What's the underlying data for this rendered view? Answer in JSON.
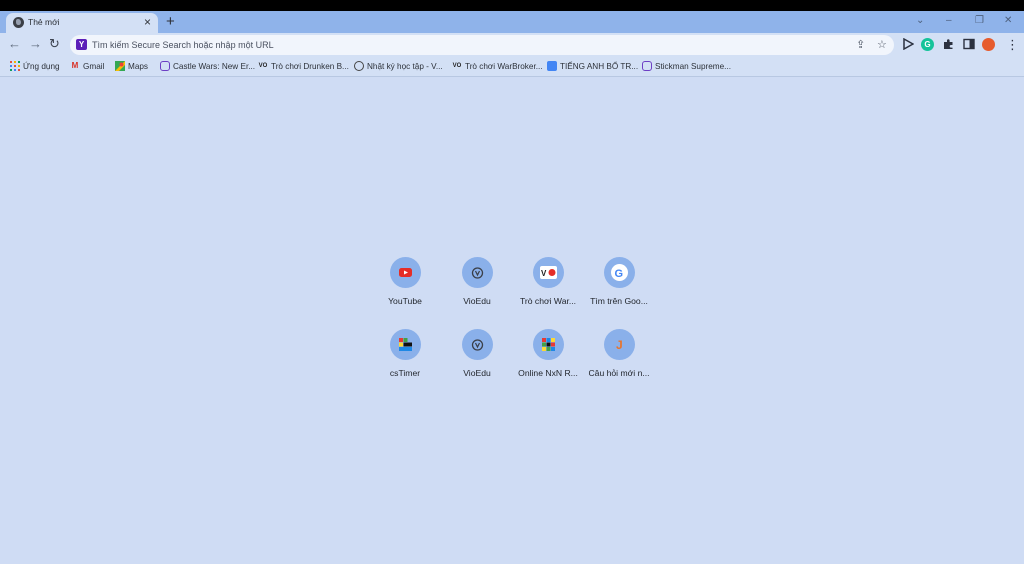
{
  "tab": {
    "title": "Thẻ mới",
    "close": "×",
    "new_tab": "+"
  },
  "window_controls": {
    "chevron": "⌄",
    "minimize": "–",
    "restore": "❐",
    "close": "✕"
  },
  "toolbar": {
    "back": "←",
    "forward": "→",
    "reload": "↻",
    "omnibox_placeholder": "Tìm kiếm Secure Search hoặc nhập một URL",
    "share": "⇪",
    "star": "☆",
    "menu": "⋮"
  },
  "bookmarks": [
    {
      "label": "Ứng dụng",
      "icon": "apps-grid-icon"
    },
    {
      "label": "Gmail",
      "icon": "gmail-icon"
    },
    {
      "label": "Maps",
      "icon": "maps-icon"
    },
    {
      "label": "Castle Wars: New Er...",
      "icon": "castle-wars-icon"
    },
    {
      "label": "Trò chơi Drunken B...",
      "icon": "vo-icon"
    },
    {
      "label": "Nhật ký học tập - V...",
      "icon": "vioedu-icon"
    },
    {
      "label": "Trò chơi WarBroker...",
      "icon": "vo-icon"
    },
    {
      "label": "TIẾNG ANH BỔ TR...",
      "icon": "docs-icon"
    },
    {
      "label": "Stickman Supreme...",
      "icon": "stickman-icon"
    }
  ],
  "shortcuts": [
    {
      "label": "YouTube",
      "icon": "youtube-icon"
    },
    {
      "label": "VioEdu",
      "icon": "vioedu-icon"
    },
    {
      "label": "Trò chơi War...",
      "icon": "vo-icon"
    },
    {
      "label": "Tìm trên Goo...",
      "icon": "google-icon"
    },
    {
      "label": "csTimer",
      "icon": "cstimer-icon"
    },
    {
      "label": "VioEdu",
      "icon": "vioedu-icon"
    },
    {
      "label": "Online NxN R...",
      "icon": "rubik-icon"
    },
    {
      "label": "Câu hỏi mới n...",
      "icon": "j-letter-icon"
    }
  ],
  "colors": {
    "accent": "#8fb3ea",
    "page_bg": "#cfdcf4",
    "youtube_red": "#e52d27",
    "secure_search_purple": "#5c1fb8"
  }
}
